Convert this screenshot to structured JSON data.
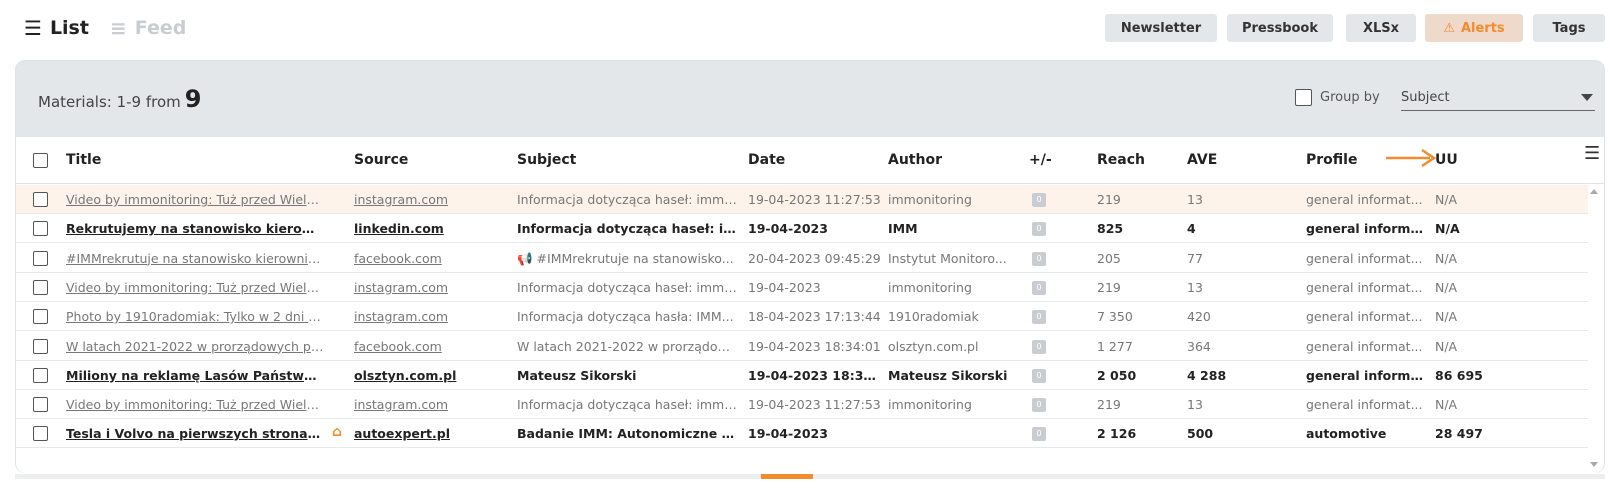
{
  "views": {
    "list_label": "List",
    "feed_label": "Feed"
  },
  "toolbar": {
    "newsletter": "Newsletter",
    "pressbook": "Pressbook",
    "xlsx": "XLSx",
    "alerts": "Alerts",
    "tags": "Tags"
  },
  "summary": {
    "label": "Materials: 1-9 from",
    "count": "9"
  },
  "group_by": {
    "label": "Group by",
    "selected": "Subject"
  },
  "columns": {
    "title": "Title",
    "source": "Source",
    "subject": "Subject",
    "date": "Date",
    "author": "Author",
    "diff": "+/-",
    "reach": "Reach",
    "ave": "AVE",
    "profile": "Profile",
    "uu": "UU"
  },
  "rows": [
    {
      "title": "Video by immonitoring: Tuż przed Wielk...",
      "source": "instagram.com",
      "subject": "Informacja dotycząca haseł: imm,...",
      "date": "19-04-2023 11:27:53",
      "author": "immonitoring",
      "diff": "0",
      "reach": "219",
      "ave": "13",
      "profile": "general informat...",
      "uu": "N/A"
    },
    {
      "title": "Rekrutujemy na stanowisko kierowni...",
      "source": "linkedin.com",
      "subject": "Informacja dotycząca haseł: im...",
      "date": "19-04-2023",
      "author": "IMM",
      "diff": "0",
      "reach": "825",
      "ave": "4",
      "profile": "general informa...",
      "uu": "N/A"
    },
    {
      "title": "#IMMrekrutuje na stanowisko kierownik...",
      "source": "facebook.com",
      "subject": "📢 #IMMrekrutuje na stanowisko...",
      "date": "20-04-2023 09:45:29",
      "author": "Instytut Monitoro...",
      "diff": "0",
      "reach": "205",
      "ave": "77",
      "profile": "general informat...",
      "uu": "N/A"
    },
    {
      "title": "Video by immonitoring: Tuż przed Wielk...",
      "source": "instagram.com",
      "subject": "Informacja dotycząca haseł: imm,...",
      "date": "19-04-2023",
      "author": "immonitoring",
      "diff": "0",
      "reach": "219",
      "ave": "13",
      "profile": "general informat...",
      "uu": "N/A"
    },
    {
      "title": "Photo by 1910radomiak: Tylko w 2 dni w ...",
      "source": "instagram.com",
      "subject": "Informacja dotycząca hasła: IMM...",
      "date": "18-04-2023 17:13:44",
      "author": "1910radomiak",
      "diff": "0",
      "reach": "7 350",
      "ave": "420",
      "profile": "general informat...",
      "uu": "N/A"
    },
    {
      "title": "W latach 2021-2022 w prorządowych pis...",
      "source": "facebook.com",
      "subject": "W latach 2021-2022 w prorządow...",
      "date": "19-04-2023 18:34:01",
      "author": "olsztyn.com.pl",
      "diff": "0",
      "reach": "1 277",
      "ave": "364",
      "profile": "general informat...",
      "uu": "N/A"
    },
    {
      "title": "Miliony na reklamę Lasów Państwowy...",
      "source": "olsztyn.com.pl",
      "subject": "Mateusz Sikorski",
      "date": "19-04-2023 18:30:00",
      "author": "Mateusz Sikorski",
      "diff": "0",
      "reach": "2 050",
      "ave": "4 288",
      "profile": "general informa...",
      "uu": "86 695"
    },
    {
      "title": "Video by immonitoring: Tuż przed Wielk...",
      "source": "instagram.com",
      "subject": "Informacja dotycząca haseł: imm,...",
      "date": "19-04-2023 11:27:53",
      "author": "immonitoring",
      "diff": "0",
      "reach": "219",
      "ave": "13",
      "profile": "general informat...",
      "uu": "N/A"
    },
    {
      "title": "Tesla i Volvo na pierwszych stronach ...",
      "source": "autoexpert.pl",
      "subject": "Badanie IMM: Autonomiczne sa...",
      "date": "19-04-2023",
      "author": "",
      "diff": "0",
      "reach": "2 126",
      "ave": "500",
      "profile": "automotive",
      "uu": "28 497"
    }
  ],
  "colors": {
    "accent": "#f28c2c",
    "panel": "#e4e7ea",
    "highlight_row": "#fdf3ea"
  },
  "icons": {
    "list": "list-icon",
    "feed": "feed-icon",
    "alert": "warning-icon",
    "column_menu": "menu-icon",
    "home": "home-icon"
  }
}
